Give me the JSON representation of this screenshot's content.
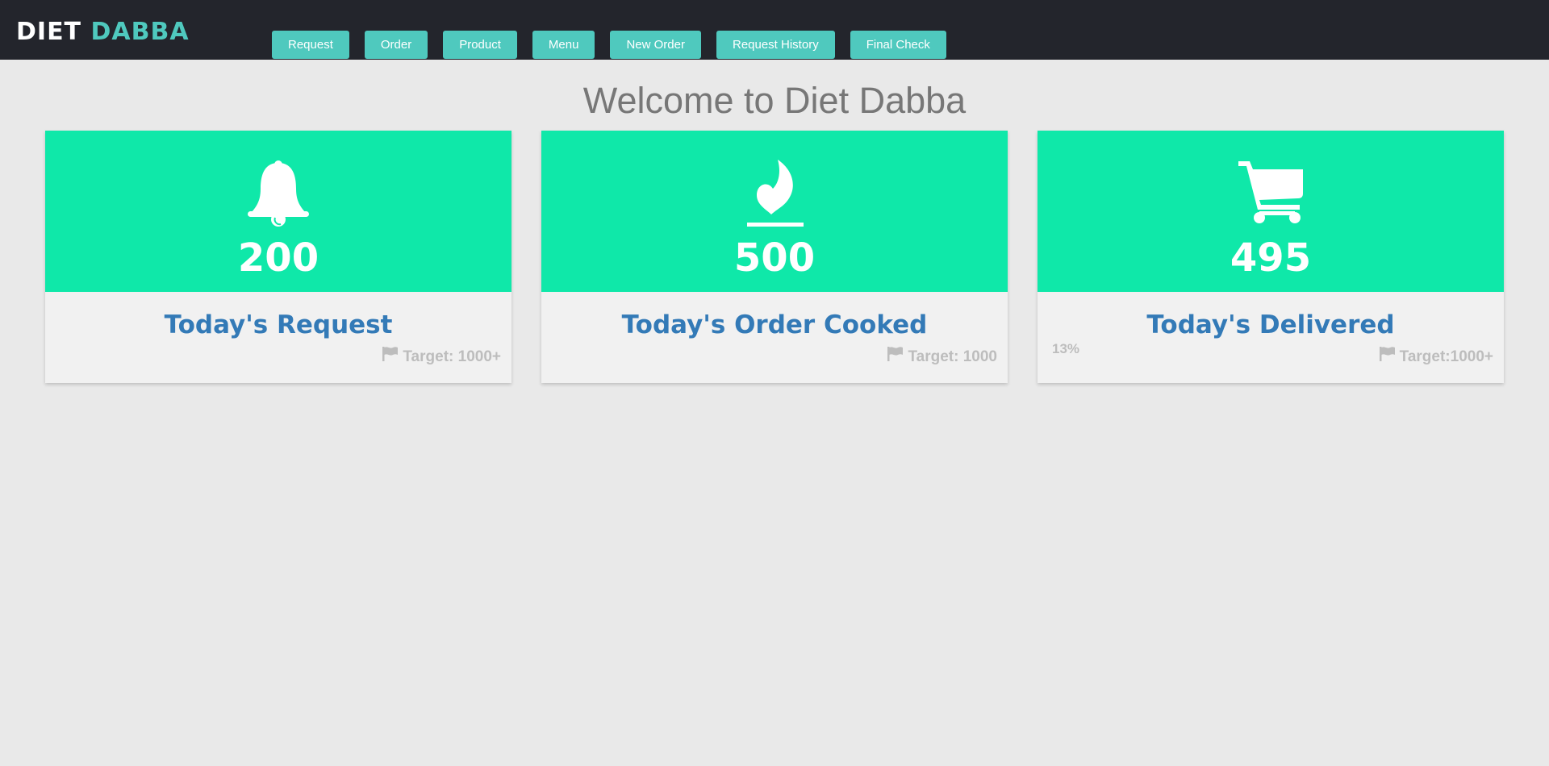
{
  "brand": {
    "part1": "DIET",
    "part2": "DABBA"
  },
  "nav": {
    "items": [
      {
        "label": "Request"
      },
      {
        "label": "Order"
      },
      {
        "label": "Product"
      },
      {
        "label": "Menu"
      },
      {
        "label": "New Order"
      },
      {
        "label": "Request History"
      },
      {
        "label": "Final Check"
      }
    ]
  },
  "welcome": "Welcome to Diet Dabba",
  "cards": [
    {
      "icon": "bell-icon",
      "value": "200",
      "title": "Today's Request",
      "target": "Target: 1000+",
      "target_icon": "flag-icon"
    },
    {
      "icon": "fire-icon",
      "value": "500",
      "title": "Today's Order Cooked",
      "target": "Target: 1000",
      "target_icon": "flag-icon"
    },
    {
      "icon": "cart-icon",
      "value": "495",
      "title": "Today's Delivered",
      "target": "Target:1000+",
      "target_icon": "flag-icon",
      "percent": "13%"
    }
  ],
  "colors": {
    "topbar": "#23252c",
    "accent": "#4fc9be",
    "card_header": "#0fe8a9",
    "card_title": "#337ab7",
    "background": "#e9e9e9"
  }
}
